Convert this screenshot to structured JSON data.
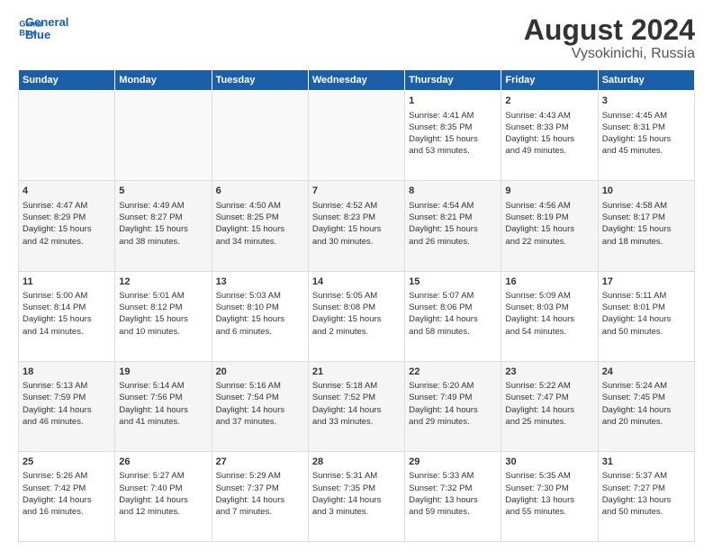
{
  "header": {
    "logo_line1": "General",
    "logo_line2": "Blue",
    "main_title": "August 2024",
    "subtitle": "Vysokinichi, Russia"
  },
  "days_of_week": [
    "Sunday",
    "Monday",
    "Tuesday",
    "Wednesday",
    "Thursday",
    "Friday",
    "Saturday"
  ],
  "weeks": [
    [
      {
        "day": "",
        "lines": []
      },
      {
        "day": "",
        "lines": []
      },
      {
        "day": "",
        "lines": []
      },
      {
        "day": "",
        "lines": []
      },
      {
        "day": "1",
        "lines": [
          "Sunrise: 4:41 AM",
          "Sunset: 8:35 PM",
          "Daylight: 15 hours",
          "and 53 minutes."
        ]
      },
      {
        "day": "2",
        "lines": [
          "Sunrise: 4:43 AM",
          "Sunset: 8:33 PM",
          "Daylight: 15 hours",
          "and 49 minutes."
        ]
      },
      {
        "day": "3",
        "lines": [
          "Sunrise: 4:45 AM",
          "Sunset: 8:31 PM",
          "Daylight: 15 hours",
          "and 45 minutes."
        ]
      }
    ],
    [
      {
        "day": "4",
        "lines": [
          "Sunrise: 4:47 AM",
          "Sunset: 8:29 PM",
          "Daylight: 15 hours",
          "and 42 minutes."
        ]
      },
      {
        "day": "5",
        "lines": [
          "Sunrise: 4:49 AM",
          "Sunset: 8:27 PM",
          "Daylight: 15 hours",
          "and 38 minutes."
        ]
      },
      {
        "day": "6",
        "lines": [
          "Sunrise: 4:50 AM",
          "Sunset: 8:25 PM",
          "Daylight: 15 hours",
          "and 34 minutes."
        ]
      },
      {
        "day": "7",
        "lines": [
          "Sunrise: 4:52 AM",
          "Sunset: 8:23 PM",
          "Daylight: 15 hours",
          "and 30 minutes."
        ]
      },
      {
        "day": "8",
        "lines": [
          "Sunrise: 4:54 AM",
          "Sunset: 8:21 PM",
          "Daylight: 15 hours",
          "and 26 minutes."
        ]
      },
      {
        "day": "9",
        "lines": [
          "Sunrise: 4:56 AM",
          "Sunset: 8:19 PM",
          "Daylight: 15 hours",
          "and 22 minutes."
        ]
      },
      {
        "day": "10",
        "lines": [
          "Sunrise: 4:58 AM",
          "Sunset: 8:17 PM",
          "Daylight: 15 hours",
          "and 18 minutes."
        ]
      }
    ],
    [
      {
        "day": "11",
        "lines": [
          "Sunrise: 5:00 AM",
          "Sunset: 8:14 PM",
          "Daylight: 15 hours",
          "and 14 minutes."
        ]
      },
      {
        "day": "12",
        "lines": [
          "Sunrise: 5:01 AM",
          "Sunset: 8:12 PM",
          "Daylight: 15 hours",
          "and 10 minutes."
        ]
      },
      {
        "day": "13",
        "lines": [
          "Sunrise: 5:03 AM",
          "Sunset: 8:10 PM",
          "Daylight: 15 hours",
          "and 6 minutes."
        ]
      },
      {
        "day": "14",
        "lines": [
          "Sunrise: 5:05 AM",
          "Sunset: 8:08 PM",
          "Daylight: 15 hours",
          "and 2 minutes."
        ]
      },
      {
        "day": "15",
        "lines": [
          "Sunrise: 5:07 AM",
          "Sunset: 8:06 PM",
          "Daylight: 14 hours",
          "and 58 minutes."
        ]
      },
      {
        "day": "16",
        "lines": [
          "Sunrise: 5:09 AM",
          "Sunset: 8:03 PM",
          "Daylight: 14 hours",
          "and 54 minutes."
        ]
      },
      {
        "day": "17",
        "lines": [
          "Sunrise: 5:11 AM",
          "Sunset: 8:01 PM",
          "Daylight: 14 hours",
          "and 50 minutes."
        ]
      }
    ],
    [
      {
        "day": "18",
        "lines": [
          "Sunrise: 5:13 AM",
          "Sunset: 7:59 PM",
          "Daylight: 14 hours",
          "and 46 minutes."
        ]
      },
      {
        "day": "19",
        "lines": [
          "Sunrise: 5:14 AM",
          "Sunset: 7:56 PM",
          "Daylight: 14 hours",
          "and 41 minutes."
        ]
      },
      {
        "day": "20",
        "lines": [
          "Sunrise: 5:16 AM",
          "Sunset: 7:54 PM",
          "Daylight: 14 hours",
          "and 37 minutes."
        ]
      },
      {
        "day": "21",
        "lines": [
          "Sunrise: 5:18 AM",
          "Sunset: 7:52 PM",
          "Daylight: 14 hours",
          "and 33 minutes."
        ]
      },
      {
        "day": "22",
        "lines": [
          "Sunrise: 5:20 AM",
          "Sunset: 7:49 PM",
          "Daylight: 14 hours",
          "and 29 minutes."
        ]
      },
      {
        "day": "23",
        "lines": [
          "Sunrise: 5:22 AM",
          "Sunset: 7:47 PM",
          "Daylight: 14 hours",
          "and 25 minutes."
        ]
      },
      {
        "day": "24",
        "lines": [
          "Sunrise: 5:24 AM",
          "Sunset: 7:45 PM",
          "Daylight: 14 hours",
          "and 20 minutes."
        ]
      }
    ],
    [
      {
        "day": "25",
        "lines": [
          "Sunrise: 5:26 AM",
          "Sunset: 7:42 PM",
          "Daylight: 14 hours",
          "and 16 minutes."
        ]
      },
      {
        "day": "26",
        "lines": [
          "Sunrise: 5:27 AM",
          "Sunset: 7:40 PM",
          "Daylight: 14 hours",
          "and 12 minutes."
        ]
      },
      {
        "day": "27",
        "lines": [
          "Sunrise: 5:29 AM",
          "Sunset: 7:37 PM",
          "Daylight: 14 hours",
          "and 7 minutes."
        ]
      },
      {
        "day": "28",
        "lines": [
          "Sunrise: 5:31 AM",
          "Sunset: 7:35 PM",
          "Daylight: 14 hours",
          "and 3 minutes."
        ]
      },
      {
        "day": "29",
        "lines": [
          "Sunrise: 5:33 AM",
          "Sunset: 7:32 PM",
          "Daylight: 13 hours",
          "and 59 minutes."
        ]
      },
      {
        "day": "30",
        "lines": [
          "Sunrise: 5:35 AM",
          "Sunset: 7:30 PM",
          "Daylight: 13 hours",
          "and 55 minutes."
        ]
      },
      {
        "day": "31",
        "lines": [
          "Sunrise: 5:37 AM",
          "Sunset: 7:27 PM",
          "Daylight: 13 hours",
          "and 50 minutes."
        ]
      }
    ]
  ]
}
